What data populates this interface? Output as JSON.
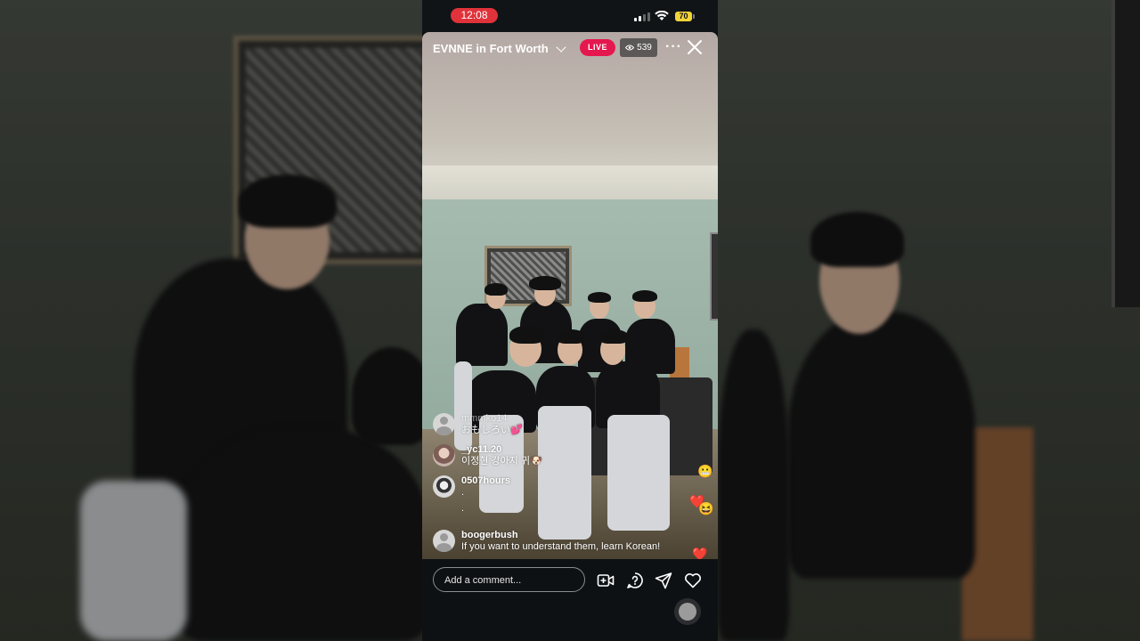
{
  "status_bar": {
    "time": "12:08",
    "battery": "70",
    "signal_icon": "cellular-signal-icon",
    "wifi_icon": "wifi-icon"
  },
  "live_header": {
    "title": "EVNNE in Fort Worth",
    "live_label": "LIVE",
    "viewer_count": "539",
    "more_label": "···"
  },
  "comments": [
    {
      "username": "mmmko14",
      "text": "おもしろい💕",
      "avatar": "avatar-default"
    },
    {
      "username": "_yc11.20",
      "text": "이정현 강아지 귀🐶",
      "avatar": "avatar-photo"
    },
    {
      "username": "0507hours",
      "text": ".",
      "text2": ".",
      "avatar": "avatar-photo"
    },
    {
      "username": "boogerbush",
      "text": "If you want to understand them, learn Korean!",
      "avatar": "avatar-default"
    }
  ],
  "reactions": [
    "😬",
    "❤️",
    "😆",
    "❤️"
  ],
  "bottom_bar": {
    "comment_placeholder": "Add a comment...",
    "icons": [
      "add-video-icon",
      "question-icon",
      "send-icon",
      "heart-icon"
    ]
  },
  "colors": {
    "live_badge": "#e5174f",
    "clock_pill": "#e0323a",
    "battery": "#f1d33a"
  }
}
